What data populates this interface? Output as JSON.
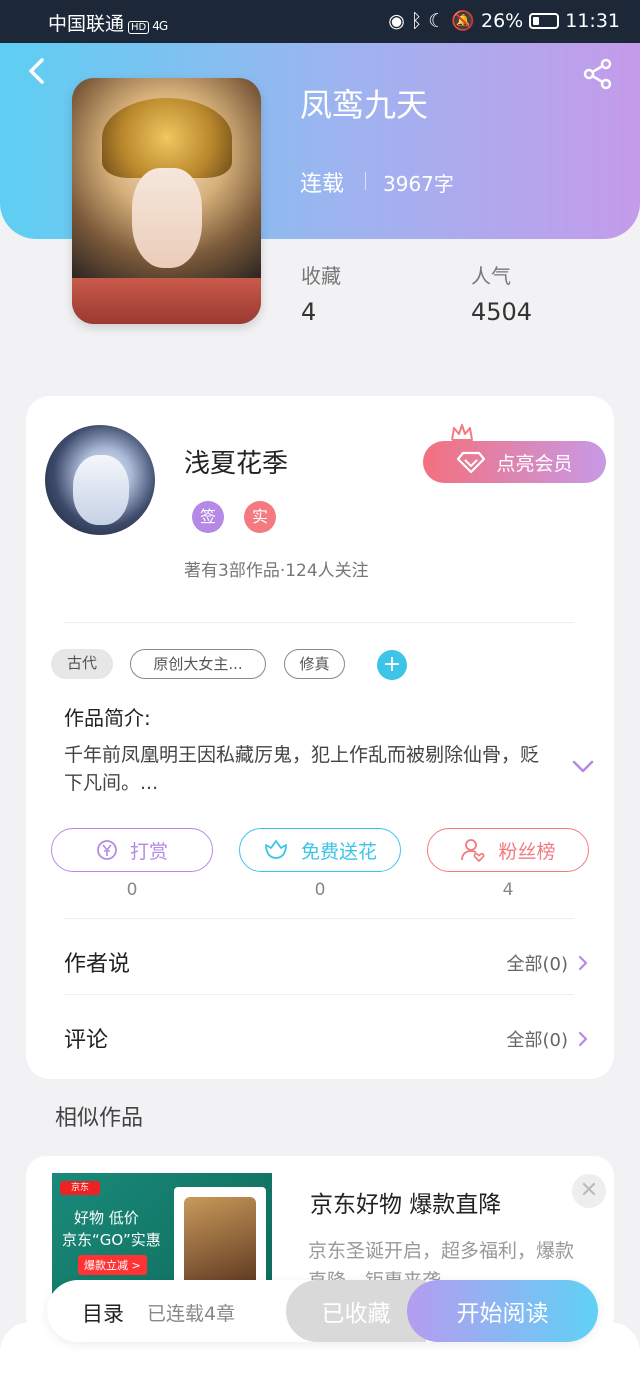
{
  "status_bar": {
    "carrier": "中国联通",
    "hd": "HD",
    "signal": "4G",
    "battery": "26%",
    "time": "11:31"
  },
  "book": {
    "title": "凤鸾九天",
    "status": "连载",
    "word_count": "3967字",
    "stats": [
      {
        "label": "收藏",
        "value": "4"
      },
      {
        "label": "人气",
        "value": "4504"
      }
    ]
  },
  "author": {
    "name": "浅夏花季",
    "badges": [
      {
        "text": "签",
        "color": "#b48ae6"
      },
      {
        "text": "实",
        "color": "#f27a80"
      }
    ],
    "meta": "著有3部作品·124人关注",
    "vip_label": "点亮会员"
  },
  "tags": [
    "古代",
    "原创大女主...",
    "修真"
  ],
  "intro": {
    "title": "作品简介:",
    "text": "千年前凤凰明王因私藏厉鬼，犯上作乱而被剔除仙骨，贬下凡间。..."
  },
  "actions": [
    {
      "label": "打赏",
      "count": "0",
      "color": "#b48ae6",
      "icon": "yen-icon"
    },
    {
      "label": "免费送花",
      "count": "0",
      "color": "#3cc5e8",
      "icon": "flower-icon"
    },
    {
      "label": "粉丝榜",
      "count": "4",
      "color": "#f27a80",
      "icon": "fan-icon"
    }
  ],
  "rows": [
    {
      "title": "作者说",
      "right": "全部(0)"
    },
    {
      "title": "评论",
      "right": "全部(0)"
    }
  ],
  "similar": {
    "title": "相似作品",
    "ad": {
      "title": "京东好物 爆款直降",
      "desc": "京东圣诞开启，超多福利，爆款直降，钜惠来袭",
      "img_logo": "京东",
      "img_line1": "好物 低价",
      "img_line2": "京东“GO”实惠",
      "img_btn": "爆款立减 >"
    }
  },
  "bottom": {
    "toc": "目录",
    "chapters": "已连载4章",
    "collected": "已收藏",
    "read": "开始阅读"
  }
}
